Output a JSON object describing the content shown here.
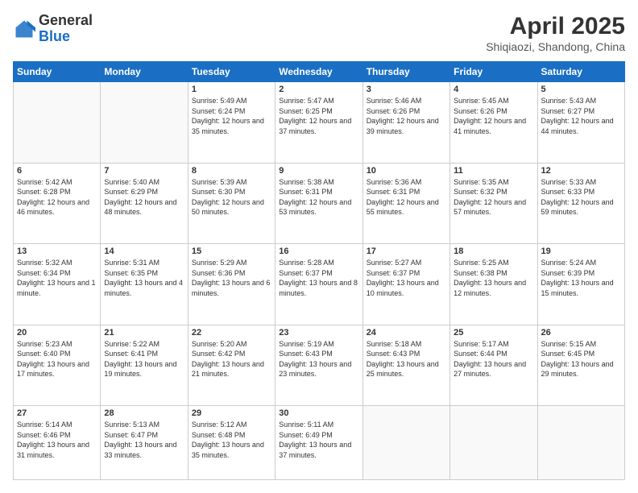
{
  "logo": {
    "general": "General",
    "blue": "Blue"
  },
  "title": "April 2025",
  "subtitle": "Shiqiaozi, Shandong, China",
  "weekdays": [
    "Sunday",
    "Monday",
    "Tuesday",
    "Wednesday",
    "Thursday",
    "Friday",
    "Saturday"
  ],
  "weeks": [
    [
      {
        "day": "",
        "sunrise": "",
        "sunset": "",
        "daylight": ""
      },
      {
        "day": "",
        "sunrise": "",
        "sunset": "",
        "daylight": ""
      },
      {
        "day": "1",
        "sunrise": "Sunrise: 5:49 AM",
        "sunset": "Sunset: 6:24 PM",
        "daylight": "Daylight: 12 hours and 35 minutes."
      },
      {
        "day": "2",
        "sunrise": "Sunrise: 5:47 AM",
        "sunset": "Sunset: 6:25 PM",
        "daylight": "Daylight: 12 hours and 37 minutes."
      },
      {
        "day": "3",
        "sunrise": "Sunrise: 5:46 AM",
        "sunset": "Sunset: 6:26 PM",
        "daylight": "Daylight: 12 hours and 39 minutes."
      },
      {
        "day": "4",
        "sunrise": "Sunrise: 5:45 AM",
        "sunset": "Sunset: 6:26 PM",
        "daylight": "Daylight: 12 hours and 41 minutes."
      },
      {
        "day": "5",
        "sunrise": "Sunrise: 5:43 AM",
        "sunset": "Sunset: 6:27 PM",
        "daylight": "Daylight: 12 hours and 44 minutes."
      }
    ],
    [
      {
        "day": "6",
        "sunrise": "Sunrise: 5:42 AM",
        "sunset": "Sunset: 6:28 PM",
        "daylight": "Daylight: 12 hours and 46 minutes."
      },
      {
        "day": "7",
        "sunrise": "Sunrise: 5:40 AM",
        "sunset": "Sunset: 6:29 PM",
        "daylight": "Daylight: 12 hours and 48 minutes."
      },
      {
        "day": "8",
        "sunrise": "Sunrise: 5:39 AM",
        "sunset": "Sunset: 6:30 PM",
        "daylight": "Daylight: 12 hours and 50 minutes."
      },
      {
        "day": "9",
        "sunrise": "Sunrise: 5:38 AM",
        "sunset": "Sunset: 6:31 PM",
        "daylight": "Daylight: 12 hours and 53 minutes."
      },
      {
        "day": "10",
        "sunrise": "Sunrise: 5:36 AM",
        "sunset": "Sunset: 6:31 PM",
        "daylight": "Daylight: 12 hours and 55 minutes."
      },
      {
        "day": "11",
        "sunrise": "Sunrise: 5:35 AM",
        "sunset": "Sunset: 6:32 PM",
        "daylight": "Daylight: 12 hours and 57 minutes."
      },
      {
        "day": "12",
        "sunrise": "Sunrise: 5:33 AM",
        "sunset": "Sunset: 6:33 PM",
        "daylight": "Daylight: 12 hours and 59 minutes."
      }
    ],
    [
      {
        "day": "13",
        "sunrise": "Sunrise: 5:32 AM",
        "sunset": "Sunset: 6:34 PM",
        "daylight": "Daylight: 13 hours and 1 minute."
      },
      {
        "day": "14",
        "sunrise": "Sunrise: 5:31 AM",
        "sunset": "Sunset: 6:35 PM",
        "daylight": "Daylight: 13 hours and 4 minutes."
      },
      {
        "day": "15",
        "sunrise": "Sunrise: 5:29 AM",
        "sunset": "Sunset: 6:36 PM",
        "daylight": "Daylight: 13 hours and 6 minutes."
      },
      {
        "day": "16",
        "sunrise": "Sunrise: 5:28 AM",
        "sunset": "Sunset: 6:37 PM",
        "daylight": "Daylight: 13 hours and 8 minutes."
      },
      {
        "day": "17",
        "sunrise": "Sunrise: 5:27 AM",
        "sunset": "Sunset: 6:37 PM",
        "daylight": "Daylight: 13 hours and 10 minutes."
      },
      {
        "day": "18",
        "sunrise": "Sunrise: 5:25 AM",
        "sunset": "Sunset: 6:38 PM",
        "daylight": "Daylight: 13 hours and 12 minutes."
      },
      {
        "day": "19",
        "sunrise": "Sunrise: 5:24 AM",
        "sunset": "Sunset: 6:39 PM",
        "daylight": "Daylight: 13 hours and 15 minutes."
      }
    ],
    [
      {
        "day": "20",
        "sunrise": "Sunrise: 5:23 AM",
        "sunset": "Sunset: 6:40 PM",
        "daylight": "Daylight: 13 hours and 17 minutes."
      },
      {
        "day": "21",
        "sunrise": "Sunrise: 5:22 AM",
        "sunset": "Sunset: 6:41 PM",
        "daylight": "Daylight: 13 hours and 19 minutes."
      },
      {
        "day": "22",
        "sunrise": "Sunrise: 5:20 AM",
        "sunset": "Sunset: 6:42 PM",
        "daylight": "Daylight: 13 hours and 21 minutes."
      },
      {
        "day": "23",
        "sunrise": "Sunrise: 5:19 AM",
        "sunset": "Sunset: 6:43 PM",
        "daylight": "Daylight: 13 hours and 23 minutes."
      },
      {
        "day": "24",
        "sunrise": "Sunrise: 5:18 AM",
        "sunset": "Sunset: 6:43 PM",
        "daylight": "Daylight: 13 hours and 25 minutes."
      },
      {
        "day": "25",
        "sunrise": "Sunrise: 5:17 AM",
        "sunset": "Sunset: 6:44 PM",
        "daylight": "Daylight: 13 hours and 27 minutes."
      },
      {
        "day": "26",
        "sunrise": "Sunrise: 5:15 AM",
        "sunset": "Sunset: 6:45 PM",
        "daylight": "Daylight: 13 hours and 29 minutes."
      }
    ],
    [
      {
        "day": "27",
        "sunrise": "Sunrise: 5:14 AM",
        "sunset": "Sunset: 6:46 PM",
        "daylight": "Daylight: 13 hours and 31 minutes."
      },
      {
        "day": "28",
        "sunrise": "Sunrise: 5:13 AM",
        "sunset": "Sunset: 6:47 PM",
        "daylight": "Daylight: 13 hours and 33 minutes."
      },
      {
        "day": "29",
        "sunrise": "Sunrise: 5:12 AM",
        "sunset": "Sunset: 6:48 PM",
        "daylight": "Daylight: 13 hours and 35 minutes."
      },
      {
        "day": "30",
        "sunrise": "Sunrise: 5:11 AM",
        "sunset": "Sunset: 6:49 PM",
        "daylight": "Daylight: 13 hours and 37 minutes."
      },
      {
        "day": "",
        "sunrise": "",
        "sunset": "",
        "daylight": ""
      },
      {
        "day": "",
        "sunrise": "",
        "sunset": "",
        "daylight": ""
      },
      {
        "day": "",
        "sunrise": "",
        "sunset": "",
        "daylight": ""
      }
    ]
  ]
}
